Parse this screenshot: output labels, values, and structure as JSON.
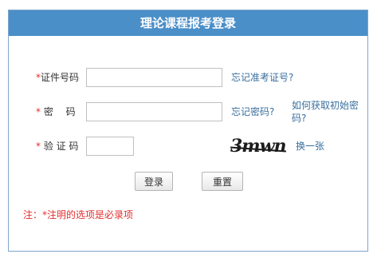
{
  "header": {
    "title": "理论课程报考登录"
  },
  "form": {
    "id_number": {
      "required_mark": "*",
      "label": "证件号码",
      "value": "",
      "link": "忘记准考证号?"
    },
    "password": {
      "required_mark": "*",
      "label": "密　 码",
      "value": "",
      "link": "忘记密码?",
      "link2": "如何获取初始密码?"
    },
    "captcha": {
      "required_mark": "*",
      "label": "验 证 码",
      "value": "",
      "image_text": "3mwn",
      "refresh_link": "换一张"
    }
  },
  "buttons": {
    "login": "登录",
    "reset": "重置"
  },
  "note": "注：*注明的选项是必录项",
  "colors": {
    "header_bg": "#4b8fc8",
    "header_text": "#ffffff",
    "required": "#e03030",
    "link": "#3a6f9f",
    "border": "#7ea6c9"
  }
}
